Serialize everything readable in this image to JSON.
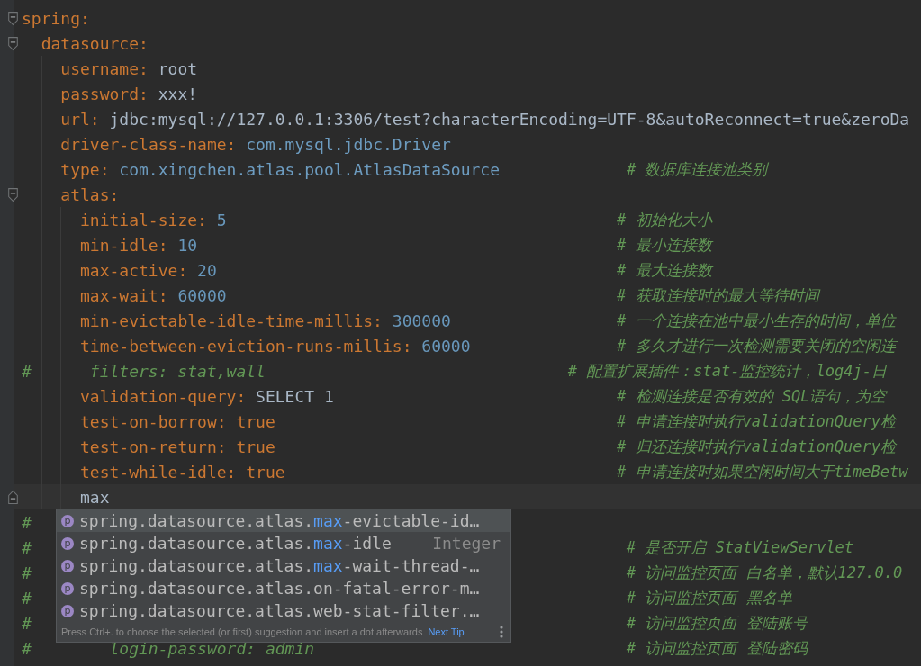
{
  "editor": {
    "lines": [
      {
        "kind": "entry",
        "key": "spring:",
        "expanded": true,
        "children": [
          {
            "kind": "entry",
            "key": "datasource:",
            "expanded": true,
            "children": [
              {
                "kind": "entry",
                "key": "username:",
                "value": {
                  "text": "root",
                  "kind": "string"
                }
              },
              {
                "kind": "entry",
                "key": "password:",
                "value": {
                  "text": "xxx!",
                  "kind": "string"
                }
              },
              {
                "kind": "entry",
                "key": "url:",
                "value": {
                  "text": "jdbc:mysql://127.0.0.1:3306/test?characterEncoding=UTF-8&autoReconnect=true&zeroDa",
                  "kind": "string"
                }
              },
              {
                "kind": "entry",
                "key": "driver-class-name:",
                "value": {
                  "text": "com.mysql.jdbc.Driver",
                  "kind": "class"
                }
              },
              {
                "kind": "entry",
                "key": "type:",
                "value": {
                  "text": "com.xingchen.atlas.pool.AtlasDataSource",
                  "kind": "class"
                },
                "comment": "# 数据库连接池类别"
              },
              {
                "kind": "entry",
                "key": "atlas:",
                "expanded": true,
                "children": [
                  {
                    "kind": "entry",
                    "key": "initial-size:",
                    "value": {
                      "text": "5",
                      "kind": "number"
                    },
                    "comment": "# 初始化大小"
                  },
                  {
                    "kind": "entry",
                    "key": "min-idle:",
                    "value": {
                      "text": "10",
                      "kind": "number"
                    },
                    "comment": "# 最小连接数"
                  },
                  {
                    "kind": "entry",
                    "key": "max-active:",
                    "value": {
                      "text": "20",
                      "kind": "number"
                    },
                    "comment": "# 最大连接数"
                  },
                  {
                    "kind": "entry",
                    "key": "max-wait:",
                    "value": {
                      "text": "60000",
                      "kind": "number"
                    },
                    "comment": "# 获取连接时的最大等待时间"
                  },
                  {
                    "kind": "entry",
                    "key": "min-evictable-idle-time-millis:",
                    "value": {
                      "text": "300000",
                      "kind": "number"
                    },
                    "comment": "# 一个连接在池中最小生存的时间，单位"
                  },
                  {
                    "kind": "entry",
                    "key": "time-between-eviction-runs-millis:",
                    "value": {
                      "text": "60000",
                      "kind": "number"
                    },
                    "comment": "# 多久才进行一次检测需要关闭的空闲连"
                  },
                  {
                    "kind": "commented",
                    "marker": "#",
                    "body": "filters: stat,wall",
                    "comment": "# 配置扩展插件：stat-监控统计，log4j-日"
                  },
                  {
                    "kind": "entry",
                    "key": "validation-query:",
                    "value": {
                      "text": "SELECT 1",
                      "kind": "string"
                    },
                    "comment": "# 检测连接是否有效的 SQL语句，为空"
                  },
                  {
                    "kind": "entry",
                    "key": "test-on-borrow:",
                    "value": {
                      "text": "true",
                      "kind": "boolean"
                    },
                    "comment": "# 申请连接时执行validationQuery检"
                  },
                  {
                    "kind": "entry",
                    "key": "test-on-return:",
                    "value": {
                      "text": "true",
                      "kind": "boolean"
                    },
                    "comment": "# 归还连接时执行validationQuery检"
                  },
                  {
                    "kind": "entry",
                    "key": "test-while-idle:",
                    "value": {
                      "text": "true",
                      "kind": "boolean"
                    },
                    "comment": "# 申请连接时如果空闲时间大于timeBetw"
                  },
                  {
                    "kind": "typing",
                    "text": "max"
                  }
                ]
              }
            ]
          }
        ]
      },
      {
        "kind": "commented",
        "marker": "#"
      },
      {
        "kind": "commented",
        "marker": "#",
        "comment": "# 是否开启 StatViewServlet"
      },
      {
        "kind": "commented",
        "marker": "#",
        "comment": "# 访问监控页面 白名单，默认127.0.0"
      },
      {
        "kind": "commented",
        "marker": "#",
        "comment": "# 访问监控页面 黑名单"
      },
      {
        "kind": "commented",
        "marker": "#",
        "comment": "# 访问监控页面 登陆账号"
      },
      {
        "kind": "commented",
        "marker": "#",
        "body": "login-password: admin",
        "comment": "# 访问监控页面 登陆密码"
      }
    ]
  },
  "completion": {
    "items": [
      {
        "badge": "p",
        "selected": true,
        "segments": [
          {
            "text": "spring.datasource.atlas.",
            "highlight": false
          },
          {
            "text": "max",
            "highlight": true
          },
          {
            "text": "-evictable-id…",
            "highlight": false
          }
        ]
      },
      {
        "badge": "p",
        "selected": false,
        "segments": [
          {
            "text": "spring.datasource.atlas.",
            "highlight": false
          },
          {
            "text": "max",
            "highlight": true
          },
          {
            "text": "-idle",
            "highlight": false
          }
        ],
        "type": "Integer"
      },
      {
        "badge": "p",
        "selected": false,
        "segments": [
          {
            "text": "spring.datasource.atlas.",
            "highlight": false
          },
          {
            "text": "max",
            "highlight": true
          },
          {
            "text": "-wait-thread-…",
            "highlight": false
          }
        ]
      },
      {
        "badge": "p",
        "selected": false,
        "segments": [
          {
            "text": "spring.datasource.atlas.on-fatal-error-m…",
            "highlight": false
          }
        ]
      },
      {
        "badge": "p",
        "selected": false,
        "segments": [
          {
            "text": "spring.datasource.atlas.web-stat-filter.…",
            "highlight": false
          }
        ]
      }
    ],
    "hint": "Press Ctrl+. to choose the selected (or first) suggestion and insert a dot afterwards",
    "link": "Next Tip"
  }
}
